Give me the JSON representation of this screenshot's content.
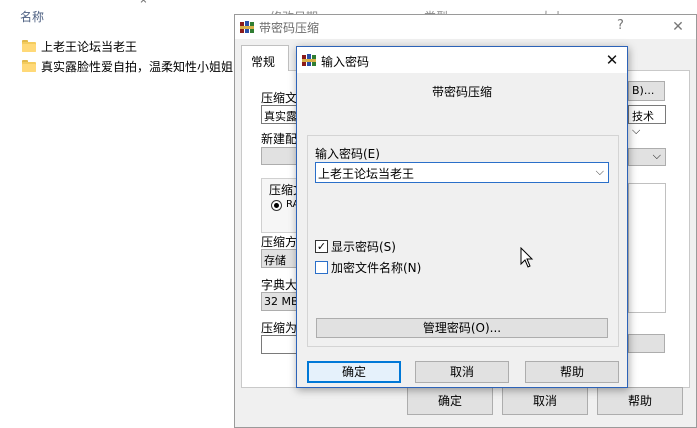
{
  "explorer": {
    "column_name": "名称",
    "column_date": "修改日期",
    "column_type": "类型",
    "column_size": "大小",
    "rows": [
      {
        "name": "上老王论坛当老王",
        "icon": "folder-icon"
      },
      {
        "name": "真实露脸性爱自拍，温柔知性小姐姐",
        "icon": "folder-icon"
      }
    ]
  },
  "back_dialog": {
    "title": "带密码压缩",
    "help": "?",
    "close": "✕",
    "tab_general": "常规",
    "labels": {
      "archive_name": "压缩文",
      "new_profile": "新建配",
      "format": "压缩文",
      "method": "压缩方",
      "dict": "字典大",
      "split": "压缩为"
    },
    "archive_value": "真实露",
    "radio_value": "RA",
    "method_value": "存储",
    "dict_value": "32 MB",
    "browse_btn": "B)...",
    "profile_combo": "技术",
    "buttons": {
      "ok": "确定",
      "cancel": "取消",
      "help": "帮助"
    }
  },
  "front_dialog": {
    "title": "输入密码",
    "close": "✕",
    "heading": "带密码压缩",
    "password_label": "输入密码(E)",
    "password_value": "上老王论坛当老王",
    "show_password_label": "显示密码(S)",
    "show_password_checked": true,
    "encrypt_names_label": "加密文件名称(N)",
    "encrypt_names_checked": false,
    "manage_btn": "管理密码(O)...",
    "buttons": {
      "ok": "确定",
      "cancel": "取消",
      "help": "帮助"
    }
  },
  "colors": {
    "accent": "#0078d7",
    "explorer_header": "#4d6082",
    "folder": "#f3cc5e"
  }
}
